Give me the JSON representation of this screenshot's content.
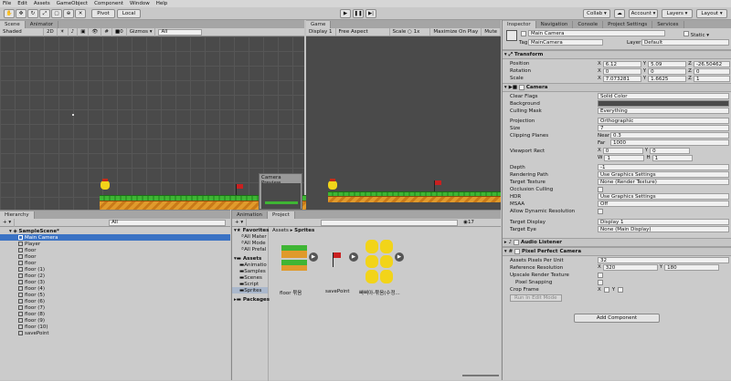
{
  "menu": [
    "File",
    "Edit",
    "Assets",
    "GameObject",
    "Component",
    "Window",
    "Help"
  ],
  "toolbar": {
    "pivot": "Pivot",
    "local": "Local",
    "collab": "Collab ▾",
    "account": "Account ▾",
    "layers": "Layers ▾",
    "layout": "Layout ▾"
  },
  "scene": {
    "tab": "Scene",
    "tab2": "Animator",
    "shading": "Shaded",
    "mode2d": "2D",
    "gizmos": "Gizmos ▾",
    "search": "All",
    "zero": "0"
  },
  "game": {
    "tab": "Game",
    "display": "Display 1",
    "aspect": "Free Aspect",
    "scale_label": "Scale",
    "scale_val": "1x",
    "maximize": "Maximize On Play",
    "mute": "Mute",
    "preview_title": "Camera Preview"
  },
  "hierarchy": {
    "tab": "Hierarchy",
    "create": "+ ▾",
    "search": "All",
    "scene": "SampleScene*",
    "items": [
      "Main Camera",
      "Player",
      "floor",
      "floor",
      "floor",
      "floor (1)",
      "floor (2)",
      "floor (3)",
      "floor (4)",
      "floor (5)",
      "floor (6)",
      "floor (7)",
      "floor (8)",
      "floor (9)",
      "floor (10)",
      "savePoint"
    ]
  },
  "project": {
    "tab_anim": "Animation",
    "tab": "Project",
    "create": "+ ▾",
    "count": "17",
    "favorites": "Favorites",
    "fav_items": [
      "All Mater",
      "All Mode",
      "All Prefal"
    ],
    "assets": "Assets",
    "asset_items": [
      "Animatio",
      "Samples",
      "Scenes",
      "Script",
      "Sprites"
    ],
    "packages": "Packages",
    "breadcrumb_root": "Assets",
    "breadcrumb_sep": "▸",
    "breadcrumb_leaf": "Sprites",
    "files": [
      "floor 묶음",
      "savePoint",
      "빠삐아-묶음(수정..."
    ]
  },
  "inspector": {
    "tab": "Inspector",
    "tab2": "Navigation",
    "tab3": "Console",
    "tab4": "Project Settings",
    "tab5": "Services",
    "name": "Main Camera",
    "static": "Static ▾",
    "tag_label": "Tag",
    "tag": "MainCamera",
    "layer_label": "Layer",
    "layer": "Default",
    "transform": {
      "title": "Transform",
      "position": "Position",
      "px": "6.12",
      "py": "5.09",
      "pz": "-26.50462",
      "rotation": "Rotation",
      "rx": "0",
      "ry": "0",
      "rz": "0",
      "scale": "Scale",
      "sx": "7.073281",
      "sy": "1.6625",
      "sz": "1"
    },
    "camera": {
      "title": "Camera",
      "clear_flags": "Clear Flags",
      "clear_flags_v": "Solid Color",
      "background": "Background",
      "culling": "Culling Mask",
      "culling_v": "Everything",
      "projection": "Projection",
      "projection_v": "Orthographic",
      "size": "Size",
      "size_v": "7",
      "clipping": "Clipping Planes",
      "near": "Near",
      "near_v": "0.3",
      "far": "Far",
      "far_v": "1000",
      "viewport": "Viewport Rect",
      "vx": "0",
      "vy": "0",
      "vw": "1",
      "vh": "1",
      "depth": "Depth",
      "depth_v": "-1",
      "rendering": "Rendering Path",
      "rendering_v": "Use Graphics Settings",
      "target_tex": "Target Texture",
      "target_tex_v": "None (Render Texture)",
      "occlusion": "Occlusion Culling",
      "hdr": "HDR",
      "hdr_v": "Use Graphics Settings",
      "msaa": "MSAA",
      "msaa_v": "Off",
      "dyn_res": "Allow Dynamic Resolution",
      "target_display": "Target Display",
      "target_display_v": "Display 1",
      "target_eye": "Target Eye",
      "target_eye_v": "None (Main Display)"
    },
    "audio": {
      "title": "Audio Listener"
    },
    "ppc": {
      "title": "Pixel Perfect Camera",
      "app": "Assets Pixels Per Unit",
      "app_v": "32",
      "ref": "Reference Resolution",
      "ref_x": "320",
      "ref_y": "180",
      "upscale": "Upscale Render Texture",
      "snap": "Pixel Snapping",
      "crop": "Crop Frame",
      "run": "Run In Edit Mode"
    },
    "add_component": "Add Component",
    "axis_x": "X",
    "axis_y": "Y",
    "axis_z": "Z",
    "axis_w": "W",
    "axis_h": "H"
  },
  "colors": {
    "scene_bg": "#4a4a4a",
    "selection": "#3a72c4",
    "grass": "#3fb534",
    "dirt": "#e09a2c"
  }
}
